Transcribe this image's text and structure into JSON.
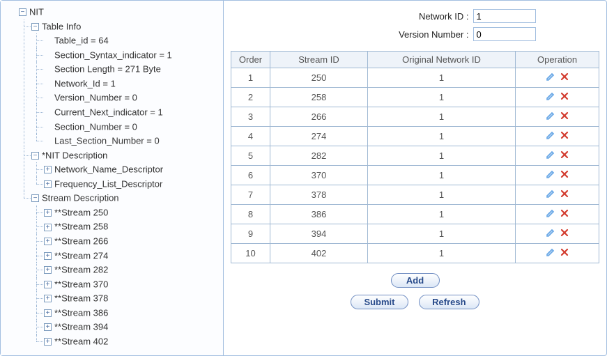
{
  "tree": {
    "root": "NIT",
    "table_info": {
      "label": "Table Info",
      "items": [
        "Table_id = 64",
        "Section_Syntax_indicator = 1",
        "Section Length = 271 Byte",
        "Network_Id = 1",
        "Version_Number = 0",
        "Current_Next_indicator = 1",
        "Section_Number = 0",
        "Last_Section_Number = 0"
      ]
    },
    "nit_desc": {
      "label": "*NIT Description",
      "items": [
        "Network_Name_Descriptor",
        "Frequency_List_Descriptor"
      ]
    },
    "stream_desc": {
      "label": "Stream Description",
      "items": [
        "**Stream 250",
        "**Stream 258",
        "**Stream 266",
        "**Stream 274",
        "**Stream 282",
        "**Stream 370",
        "**Stream 378",
        "**Stream 386",
        "**Stream 394",
        "**Stream 402"
      ]
    }
  },
  "form": {
    "network_id_label": "Network ID :",
    "network_id_value": "1",
    "version_label": "Version Number :",
    "version_value": "0"
  },
  "table": {
    "headers": {
      "order": "Order",
      "stream_id": "Stream ID",
      "original_network_id": "Original Network ID",
      "operation": "Operation"
    },
    "rows": [
      {
        "order": "1",
        "stream_id": "250",
        "original_network_id": "1"
      },
      {
        "order": "2",
        "stream_id": "258",
        "original_network_id": "1"
      },
      {
        "order": "3",
        "stream_id": "266",
        "original_network_id": "1"
      },
      {
        "order": "4",
        "stream_id": "274",
        "original_network_id": "1"
      },
      {
        "order": "5",
        "stream_id": "282",
        "original_network_id": "1"
      },
      {
        "order": "6",
        "stream_id": "370",
        "original_network_id": "1"
      },
      {
        "order": "7",
        "stream_id": "378",
        "original_network_id": "1"
      },
      {
        "order": "8",
        "stream_id": "386",
        "original_network_id": "1"
      },
      {
        "order": "9",
        "stream_id": "394",
        "original_network_id": "1"
      },
      {
        "order": "10",
        "stream_id": "402",
        "original_network_id": "1"
      }
    ]
  },
  "buttons": {
    "add": "Add",
    "submit": "Submit",
    "refresh": "Refresh"
  },
  "icons": {
    "edit": "edit-icon",
    "delete": "delete-icon"
  },
  "colors": {
    "border": "#a3bfe0",
    "button_text": "#274a8a",
    "edit_icon": "#6aa8e6",
    "delete_icon": "#d23b2e"
  }
}
